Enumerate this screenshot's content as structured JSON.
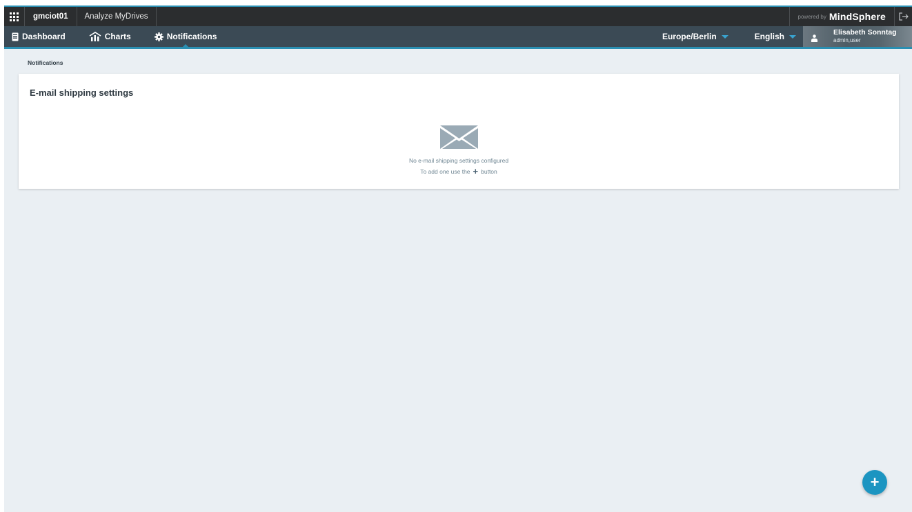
{
  "topbar": {
    "tenant": "gmciot01",
    "app_name": "Analyze MyDrives",
    "powered_by": "powered by",
    "brand": "MindSphere"
  },
  "nav": {
    "items": [
      {
        "label": "Dashboard",
        "icon": "dashboard-icon"
      },
      {
        "label": "Charts",
        "icon": "charts-icon"
      },
      {
        "label": "Notifications",
        "icon": "gear-icon",
        "active": true
      }
    ],
    "timezone": "Europe/Berlin",
    "language": "English",
    "user": {
      "name": "Elisabeth Sonntag",
      "roles": "admin,user"
    }
  },
  "breadcrumb": "Notifications",
  "card": {
    "title": "E-mail shipping settings",
    "empty_message": "No e-mail shipping settings configured",
    "hint_before": "To add one use the",
    "hint_after": "button",
    "icon": "envelope-icon"
  },
  "fab": {
    "icon": "plus-icon",
    "symbol": "+"
  },
  "colors": {
    "accent": "#2a8fb2",
    "topbar": "#2b2d2f",
    "navbar": "#3b4a55",
    "background": "#eaeff3",
    "fab": "#1c95c1"
  }
}
